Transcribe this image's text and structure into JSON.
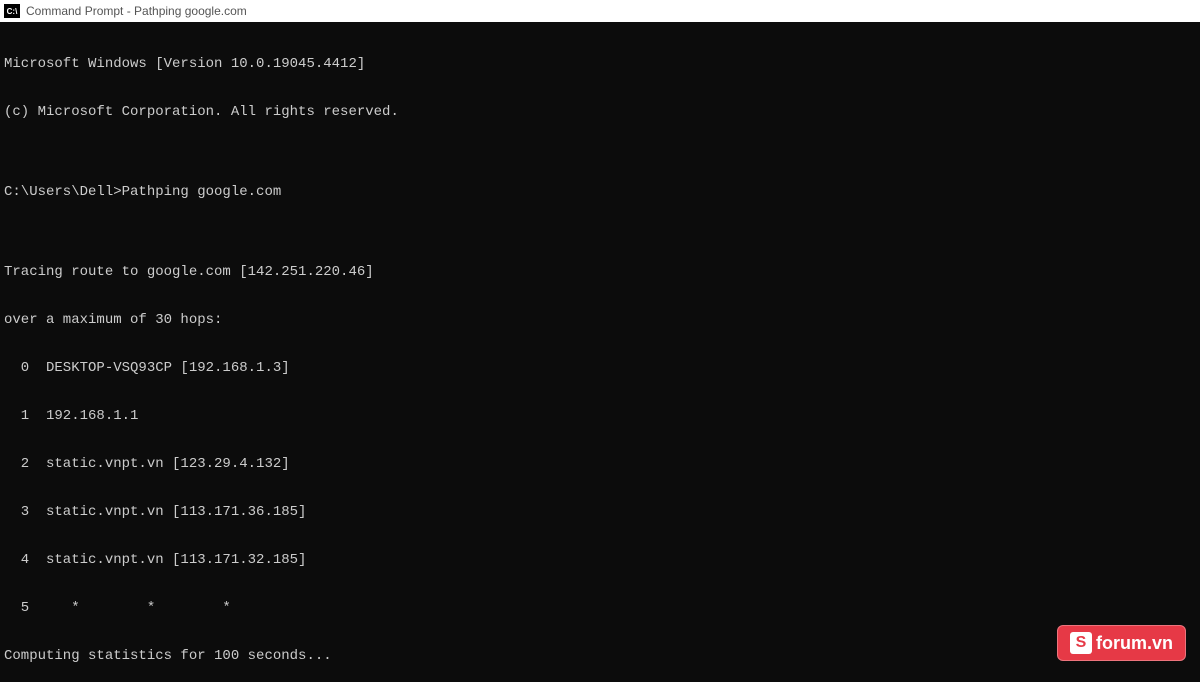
{
  "titlebar": {
    "icon_text": "C:\\",
    "title": "Command Prompt - Pathping  google.com"
  },
  "terminal": {
    "lines": [
      "Microsoft Windows [Version 10.0.19045.4412]",
      "(c) Microsoft Corporation. All rights reserved.",
      "",
      "C:\\Users\\Dell>Pathping google.com",
      "",
      "Tracing route to google.com [142.251.220.46]",
      "over a maximum of 30 hops:",
      "  0  DESKTOP-VSQ93CP [192.168.1.3]",
      "  1  192.168.1.1",
      "  2  static.vnpt.vn [123.29.4.132]",
      "  3  static.vnpt.vn [113.171.36.185]",
      "  4  static.vnpt.vn [113.171.32.185]",
      "  5     *        *        *",
      "Computing statistics for 100 seconds..."
    ]
  },
  "watermark": {
    "icon": "S",
    "text": "forum.vn"
  }
}
